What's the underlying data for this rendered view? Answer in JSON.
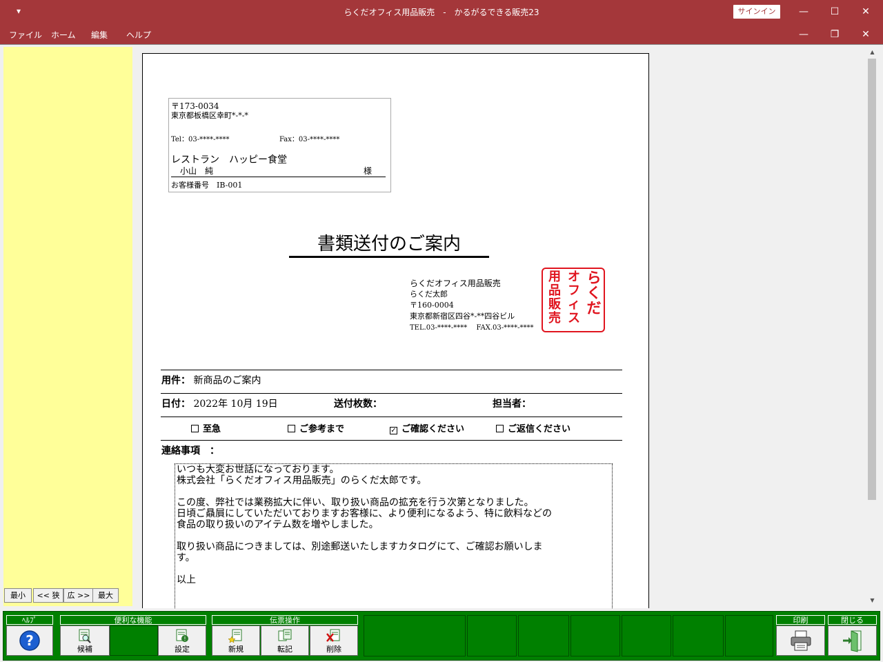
{
  "window": {
    "title": "らくだオフィス用品販売　-　かるがるできる販売23",
    "quick_access": "▾",
    "signin": "サインイン",
    "minimize": "—",
    "maximize": "☐",
    "close": "✕"
  },
  "menu": {
    "items": [
      "ファイル",
      "ホーム",
      "編集",
      "ヘルプ"
    ],
    "doc_minimize": "—",
    "doc_restore": "❐",
    "doc_close": "✕"
  },
  "zoom": {
    "min": "最小",
    "narrow": "<< 狭",
    "wide": "広 >>",
    "max": "最大"
  },
  "address": {
    "postal": "〒173-0034",
    "addr": "東京都板橋区幸町*-*-*",
    "tel": "Tel：03-****-****",
    "fax": "Fax：03-****-****",
    "company": "レストラン　ハッピー食堂",
    "person": "小山　純",
    "honorific": "様",
    "customer_no": "お客様番号　IB-001"
  },
  "document": {
    "title": "書類送付のご案内"
  },
  "sender": {
    "company": "らくだオフィス用品販売",
    "name": "らくだ太郎",
    "postal": "〒160-0004",
    "addr": "東京都新宿区四谷*-**四谷ビル",
    "telfax": "TEL.03-****-****　 FAX.03-****-****"
  },
  "stamp": {
    "col1": "らくだ",
    "col2": "オフィス",
    "col3": "用品販売"
  },
  "fields": {
    "subject_label": "用件：",
    "subject_value": "新商品のご案内",
    "date_label": "日付：",
    "date_value": "2022年 10月 19日",
    "pages_label": "送付枚数：",
    "staff_label": "担当者：",
    "notes_label": "連絡事項　："
  },
  "checks": [
    {
      "label": "至急",
      "checked": false
    },
    {
      "label": "ご参考まで",
      "checked": false
    },
    {
      "label": "ご確認ください",
      "checked": true
    },
    {
      "label": "ご返信ください",
      "checked": false
    }
  ],
  "notes": [
    "いつも大変お世話になっております。",
    "株式会社「らくだオフィス用品販売」のらくだ太郎です。",
    "",
    "この度、弊社では業務拡大に伴い、取り扱い商品の拡充を行う次第となりました。",
    "日頃ご贔屓にしていただいておりますお客様に、より便利になるよう、特に飲料などの",
    "食品の取り扱いのアイテム数を増やしました。",
    "",
    "取り扱い商品につきましては、別途郵送いたしますカタログにて、ご確認お願いしま",
    "す。",
    "",
    "以上"
  ],
  "toolbar": {
    "help_header": "ﾍﾙﾌﾟ",
    "convenient_header": "便利な機能",
    "voucher_header": "伝票操作",
    "print_header": "印刷",
    "close_header": "閉じる",
    "candidate": "候補",
    "settings": "設定",
    "new": "新規",
    "transfer": "転記",
    "delete": "削除"
  },
  "colors": {
    "titlebar": "#a4373a",
    "toolbar_green": "#008000",
    "left_panel": "#ffff99",
    "stamp_red": "#e0141e"
  }
}
